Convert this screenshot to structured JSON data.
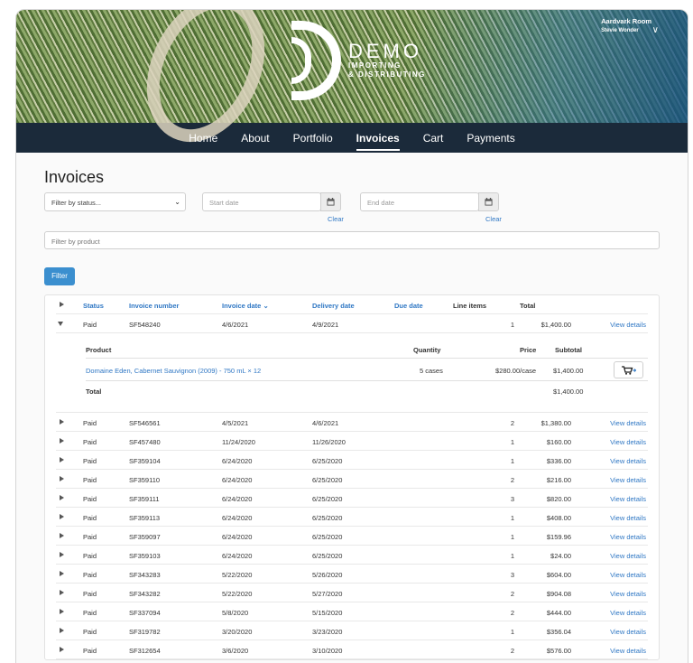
{
  "brand": {
    "name": "DEMO",
    "line1": "IMPORTING",
    "line2": "& DISTRIBUTING"
  },
  "user": {
    "room": "Aardvark Room",
    "name": "Stevie Wonder"
  },
  "nav": [
    {
      "label": "Home"
    },
    {
      "label": "About"
    },
    {
      "label": "Portfolio"
    },
    {
      "label": "Invoices"
    },
    {
      "label": "Cart"
    },
    {
      "label": "Payments"
    }
  ],
  "page_title": "Invoices",
  "filters": {
    "status_placeholder": "Filter by status...",
    "start_date_placeholder": "Start date",
    "end_date_placeholder": "End date",
    "clear_label": "Clear",
    "product_placeholder": "Filter by product",
    "filter_button": "Filter"
  },
  "table": {
    "headers": {
      "status": "Status",
      "invoice_number": "Invoice number",
      "invoice_date": "Invoice date",
      "delivery_date": "Delivery date",
      "due_date": "Due date",
      "line_items": "Line items",
      "total": "Total"
    },
    "view_details": "View details",
    "expanded": {
      "status": "Paid",
      "number": "SF548240",
      "invoice_date": "4/6/2021",
      "delivery_date": "4/9/2021",
      "line_items": "1",
      "total": "$1,400.00"
    },
    "detail": {
      "headers": {
        "product": "Product",
        "quantity": "Quantity",
        "price": "Price",
        "subtotal": "Subtotal"
      },
      "product": "Domaine Eden, Cabernet Sauvignon (2009) - 750 mL × 12",
      "quantity": "5 cases",
      "price": "$280.00/case",
      "subtotal": "$1,400.00",
      "total_label": "Total",
      "total": "$1,400.00"
    },
    "rows": [
      {
        "status": "Paid",
        "number": "SF546561",
        "invoice_date": "4/5/2021",
        "delivery_date": "4/6/2021",
        "line_items": "2",
        "total": "$1,380.00"
      },
      {
        "status": "Paid",
        "number": "SF457480",
        "invoice_date": "11/24/2020",
        "delivery_date": "11/26/2020",
        "line_items": "1",
        "total": "$160.00"
      },
      {
        "status": "Paid",
        "number": "SF359104",
        "invoice_date": "6/24/2020",
        "delivery_date": "6/25/2020",
        "line_items": "1",
        "total": "$336.00"
      },
      {
        "status": "Paid",
        "number": "SF359110",
        "invoice_date": "6/24/2020",
        "delivery_date": "6/25/2020",
        "line_items": "2",
        "total": "$216.00"
      },
      {
        "status": "Paid",
        "number": "SF359111",
        "invoice_date": "6/24/2020",
        "delivery_date": "6/25/2020",
        "line_items": "3",
        "total": "$820.00"
      },
      {
        "status": "Paid",
        "number": "SF359113",
        "invoice_date": "6/24/2020",
        "delivery_date": "6/25/2020",
        "line_items": "1",
        "total": "$408.00"
      },
      {
        "status": "Paid",
        "number": "SF359097",
        "invoice_date": "6/24/2020",
        "delivery_date": "6/25/2020",
        "line_items": "1",
        "total": "$159.96"
      },
      {
        "status": "Paid",
        "number": "SF359103",
        "invoice_date": "6/24/2020",
        "delivery_date": "6/25/2020",
        "line_items": "1",
        "total": "$24.00"
      },
      {
        "status": "Paid",
        "number": "SF343283",
        "invoice_date": "5/22/2020",
        "delivery_date": "5/26/2020",
        "line_items": "3",
        "total": "$604.00"
      },
      {
        "status": "Paid",
        "number": "SF343282",
        "invoice_date": "5/22/2020",
        "delivery_date": "5/27/2020",
        "line_items": "2",
        "total": "$904.08"
      },
      {
        "status": "Paid",
        "number": "SF337094",
        "invoice_date": "5/8/2020",
        "delivery_date": "5/15/2020",
        "line_items": "2",
        "total": "$444.00"
      },
      {
        "status": "Paid",
        "number": "SF319782",
        "invoice_date": "3/20/2020",
        "delivery_date": "3/23/2020",
        "line_items": "1",
        "total": "$356.04"
      },
      {
        "status": "Paid",
        "number": "SF312654",
        "invoice_date": "3/6/2020",
        "delivery_date": "3/10/2020",
        "line_items": "2",
        "total": "$576.00"
      }
    ]
  },
  "colors": {
    "nav_bg": "#1b2a3a",
    "link": "#2f77c4",
    "button": "#3b8fcf"
  }
}
